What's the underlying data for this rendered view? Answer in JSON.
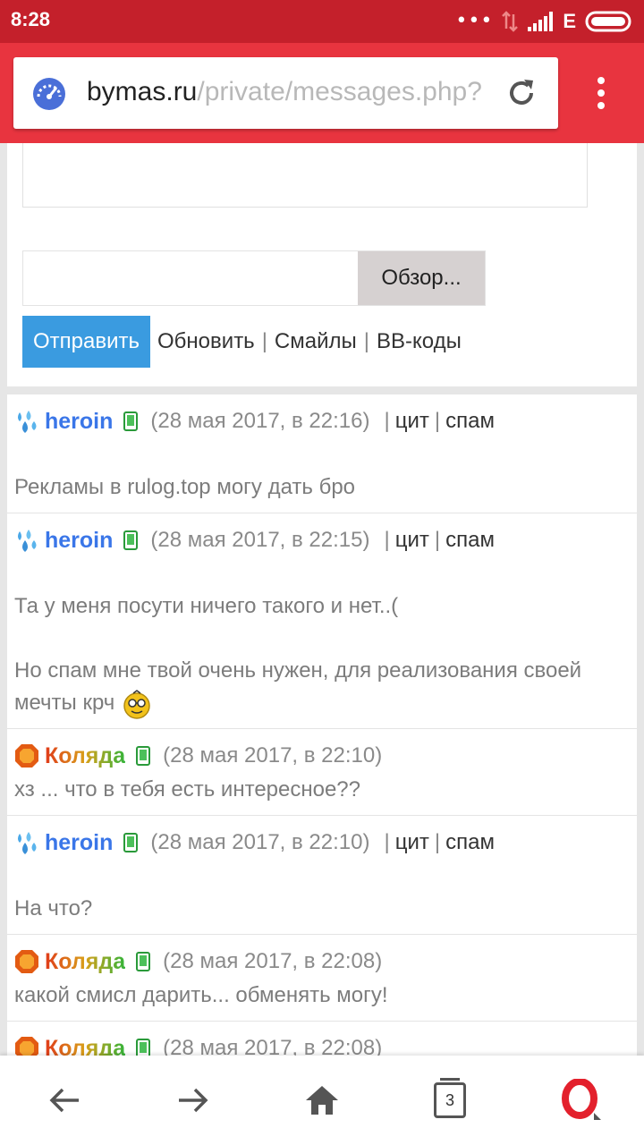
{
  "status_bar": {
    "time": "8:28",
    "network": "E",
    "icons": [
      "dots-icon",
      "data-arrows-icon",
      "signal-icon",
      "battery-icon"
    ]
  },
  "browser": {
    "url_host": "bymas.ru",
    "url_path": "/private/messages.php?",
    "icons": [
      "speed-dial-icon",
      "reload-icon",
      "menu-icon"
    ]
  },
  "form": {
    "browse_label": "Обзор...",
    "send_label": "Отправить",
    "refresh_label": "Обновить",
    "smiles_label": "Смайлы",
    "bbcodes_label": "BB-коды",
    "separator": "|"
  },
  "messages": [
    {
      "user": "heroin",
      "date": "(28 мая 2017, в 22:16)",
      "links": [
        "цит",
        "спам"
      ],
      "body": [
        "Рекламы в rulog.top могу дать бро"
      ]
    },
    {
      "user": "heroin",
      "date": "(28 мая 2017, в 22:15)",
      "links": [
        "цит",
        "спам"
      ],
      "body": [
        "Та у меня посути ничего такого и нет..(",
        "Но спам мне твой очень нужен, для реализования своей",
        "мечты крч"
      ]
    },
    {
      "user": "Коляда",
      "date": "(28 мая 2017, в 22:10)",
      "body": [
        "хз ... что в тебя есть интересное??"
      ]
    },
    {
      "user": "heroin",
      "date": "(28 мая 2017, в 22:10)",
      "links": [
        "цит",
        "спам"
      ],
      "body": [
        "На что?"
      ]
    },
    {
      "user": "Коляда",
      "date": "(28 мая 2017, в 22:08)",
      "body": [
        "какой смисл дарить... обменять могу!"
      ]
    },
    {
      "user": "Коляда",
      "date": "(28 мая 2017, в 22:08)",
      "body": []
    }
  ],
  "bottom_nav": {
    "tabs_count": "3",
    "icons": [
      "back-arrow-icon",
      "forward-arrow-icon",
      "home-icon",
      "tabs-icon",
      "opera-icon"
    ]
  },
  "colors": {
    "status_bar": "#c4202b",
    "toolbar": "#e8343f",
    "send_button": "#3a9be0",
    "username_blue": "#3a76e8"
  }
}
